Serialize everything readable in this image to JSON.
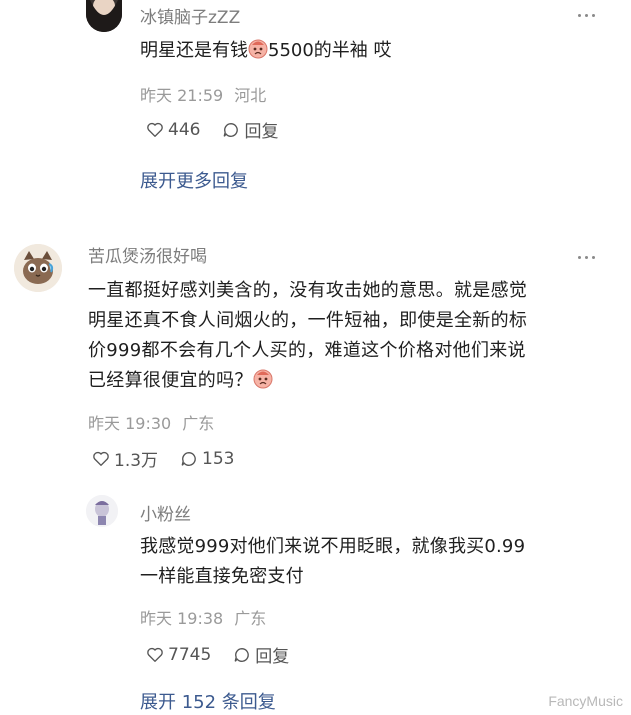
{
  "comments": [
    {
      "username": "冰镇脑子zZZ",
      "text_before_emoji": "明星还是有钱",
      "emoji": "crying-face-emoji",
      "text_after_emoji": "5500的半袖 哎",
      "time": "昨天 21:59",
      "location": "河北",
      "likes": "446",
      "reply_label": "回复",
      "expand_label": "展开更多回复"
    },
    {
      "username": "苦瓜煲汤很好喝",
      "text_lines": [
        "一直都挺好感刘美含的，没有攻击她的意思。就是感觉",
        "明星还真不食人间烟火的，一件短袖，即使是全新的标",
        "价999都不会有几个人买的，难道这个价格对他们来说",
        "已经算很便宜的吗？"
      ],
      "emoji": "crying-face-emoji",
      "time": "昨天 19:30",
      "location": "广东",
      "likes": "1.3万",
      "replies": "153"
    }
  ],
  "reply": {
    "username": "小粉丝",
    "text_lines": [
      "我感觉999对他们来说不用眨眼，就像我买0.99",
      "一样能直接免密支付"
    ],
    "time": "昨天 19:38",
    "location": "广东",
    "likes": "7745",
    "reply_label": "回复",
    "expand_label": "展开 152 条回复"
  },
  "watermark": "FancyMusic",
  "colors": {
    "link": "#3c5a8f",
    "meta": "#9a9a9a",
    "username": "#7d7d7d"
  }
}
